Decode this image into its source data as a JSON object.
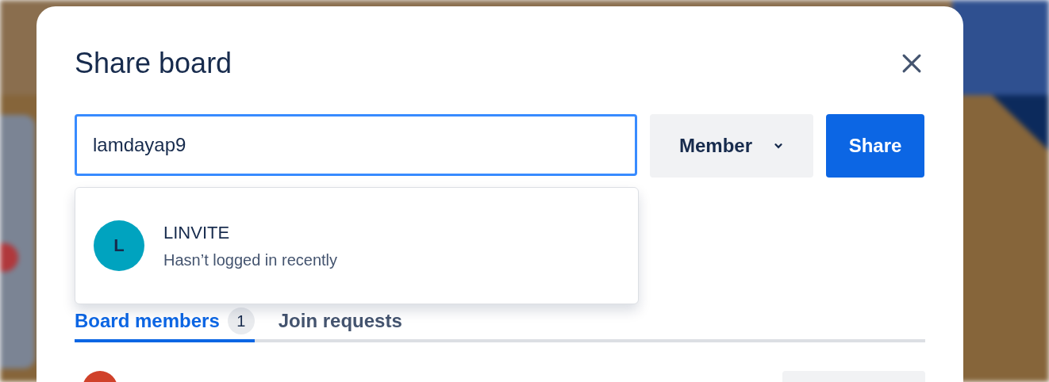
{
  "dialog": {
    "title": "Share board"
  },
  "invite": {
    "value": "lamdayap9",
    "role": "Member",
    "button": "Share"
  },
  "suggestions": [
    {
      "initial": "L",
      "name": "LINVITE",
      "status": "Hasn’t logged in recently",
      "color": "#00a3bf"
    }
  ],
  "tabs": [
    {
      "label": "Board members",
      "count": "1",
      "selected": true
    },
    {
      "label": "Join requests",
      "selected": false
    }
  ]
}
